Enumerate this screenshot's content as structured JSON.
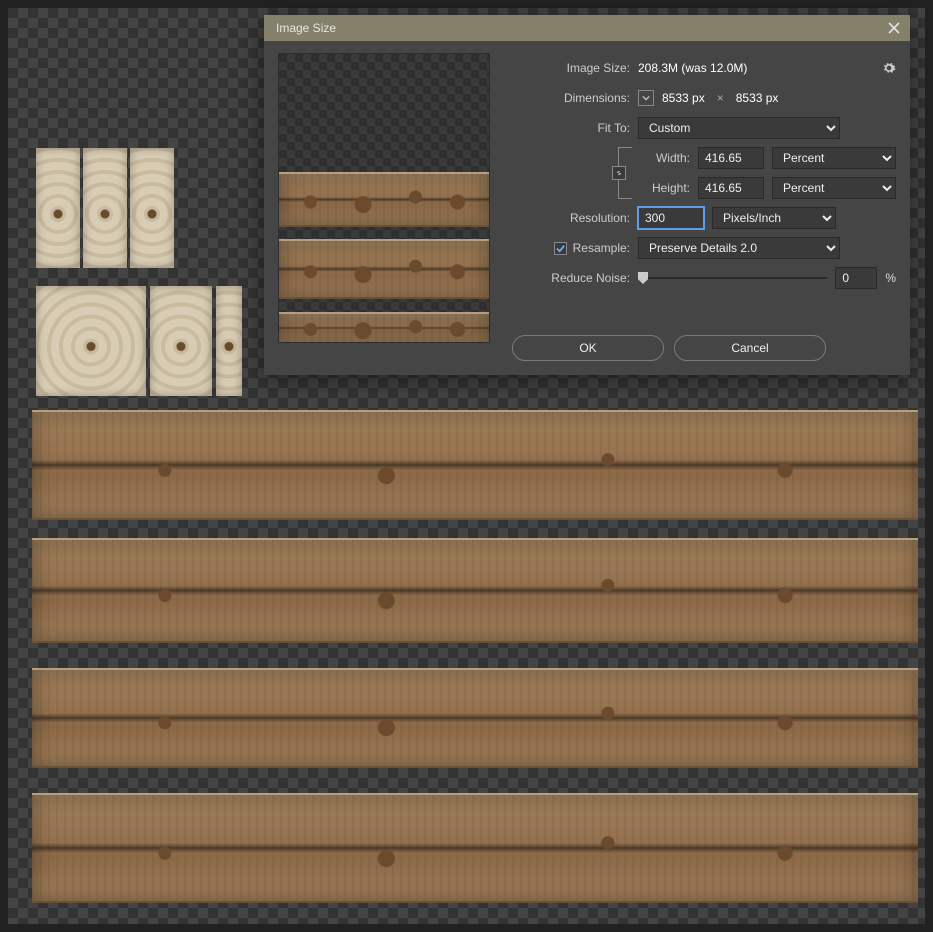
{
  "dialog": {
    "title": "Image Size",
    "image_size_label": "Image Size:",
    "image_size_value": "208.3M (was 12.0M)",
    "dimensions_label": "Dimensions:",
    "dimensions_w": "8533 px",
    "dimensions_h": "8533 px",
    "dimensions_sep": "×",
    "fit_to_label": "Fit To:",
    "fit_to_value": "Custom",
    "width_label": "Width:",
    "width_value": "416.65",
    "width_unit": "Percent",
    "height_label": "Height:",
    "height_value": "416.65",
    "height_unit": "Percent",
    "resolution_label": "Resolution:",
    "resolution_value": "300",
    "resolution_unit": "Pixels/Inch",
    "resample_label": "Resample:",
    "resample_value": "Preserve Details 2.0",
    "noise_label": "Reduce Noise:",
    "noise_value": "0",
    "noise_pct": "%",
    "ok": "OK",
    "cancel": "Cancel"
  }
}
